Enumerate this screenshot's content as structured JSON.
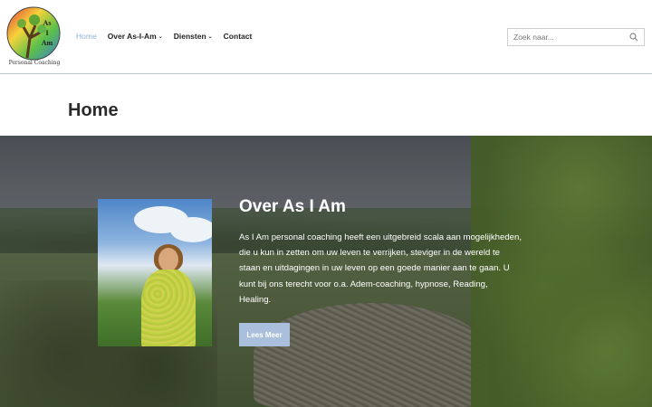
{
  "logo": {
    "initials_line1": "As",
    "initials_line2": "I",
    "initials_line3": "Am",
    "tagline": "Personal Coaching"
  },
  "nav": {
    "items": [
      {
        "label": "Home",
        "active": true,
        "has_dropdown": false
      },
      {
        "label": "Over As-I-Am",
        "active": false,
        "has_dropdown": true
      },
      {
        "label": "Diensten",
        "active": false,
        "has_dropdown": true
      },
      {
        "label": "Contact",
        "active": false,
        "has_dropdown": false
      }
    ]
  },
  "search": {
    "placeholder": "Zoek naar...",
    "value": "",
    "icon": "search-icon"
  },
  "page": {
    "title": "Home"
  },
  "hero": {
    "title": "Over As I Am",
    "text": "As I Am personal coaching heeft een uitgebreid scala aan mogelijkheden, die u kun in zetten om uw leven te verrijken, steviger in de wereld te staan en uitdagingen in uw leven op een goede manier aan te gaan. U kunt bij ons terecht voor o.a. Adem-coaching, hypnose, Reading, Healing.",
    "button_label": "Lees Meer"
  },
  "colors": {
    "accent": "#8eb0d6",
    "button": "#a9bfdc",
    "header_border": "#b6c7dc"
  }
}
